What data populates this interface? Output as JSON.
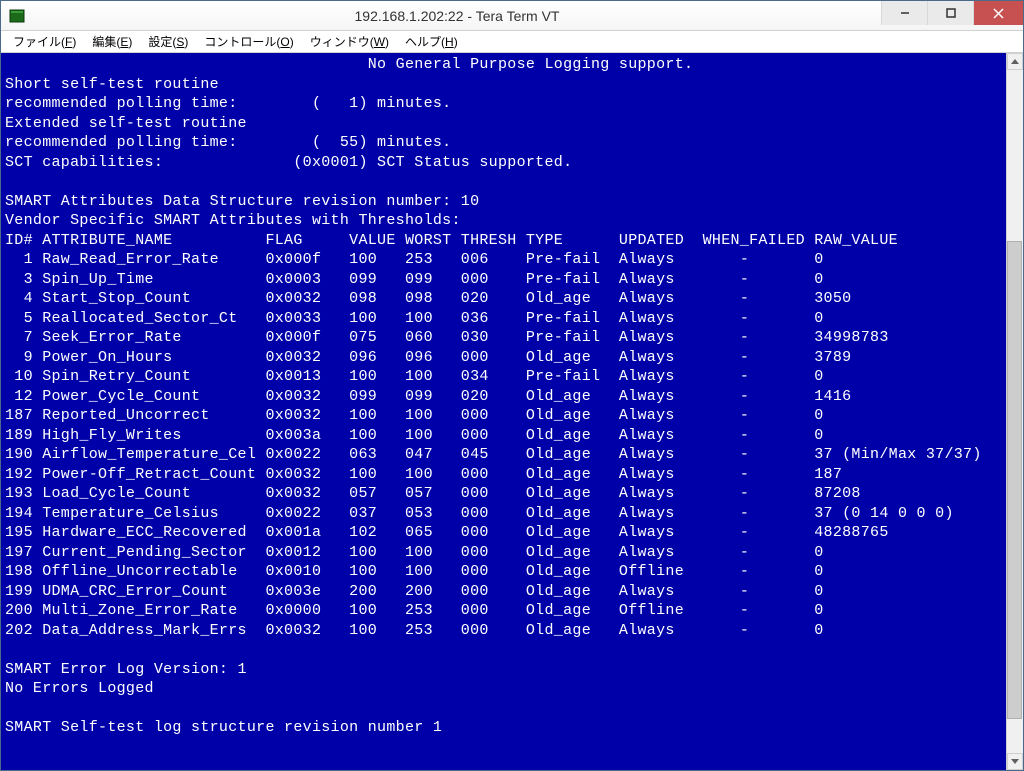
{
  "window": {
    "title": "192.168.1.202:22 - Tera Term VT"
  },
  "menu": {
    "file": "ファイル(",
    "file_u": "F",
    "file_end": ")",
    "edit": "編集(",
    "edit_u": "E",
    "edit_end": ")",
    "setup": "設定(",
    "setup_u": "S",
    "setup_end": ")",
    "control": "コントロール(",
    "control_u": "O",
    "control_end": ")",
    "window_m": "ウィンドウ(",
    "window_u": "W",
    "window_end": ")",
    "help": "ヘルプ(",
    "help_u": "H",
    "help_end": ")"
  },
  "term": {
    "line0": "                                       No General Purpose Logging support.",
    "line1": "Short self-test routine",
    "line2": "recommended polling time:        (   1) minutes.",
    "line3": "Extended self-test routine",
    "line4": "recommended polling time:        (  55) minutes.",
    "line5": "SCT capabilities:              (0x0001) SCT Status supported.",
    "line6": "",
    "line7": "SMART Attributes Data Structure revision number: 10",
    "line8": "Vendor Specific SMART Attributes with Thresholds:",
    "header": "ID# ATTRIBUTE_NAME          FLAG     VALUE WORST THRESH TYPE      UPDATED  WHEN_FAILED RAW_VALUE",
    "rows": [
      "  1 Raw_Read_Error_Rate     0x000f   100   253   006    Pre-fail  Always       -       0",
      "  3 Spin_Up_Time            0x0003   099   099   000    Pre-fail  Always       -       0",
      "  4 Start_Stop_Count        0x0032   098   098   020    Old_age   Always       -       3050",
      "  5 Reallocated_Sector_Ct   0x0033   100   100   036    Pre-fail  Always       -       0",
      "  7 Seek_Error_Rate         0x000f   075   060   030    Pre-fail  Always       -       34998783",
      "  9 Power_On_Hours          0x0032   096   096   000    Old_age   Always       -       3789",
      " 10 Spin_Retry_Count        0x0013   100   100   034    Pre-fail  Always       -       0",
      " 12 Power_Cycle_Count       0x0032   099   099   020    Old_age   Always       -       1416",
      "187 Reported_Uncorrect      0x0032   100   100   000    Old_age   Always       -       0",
      "189 High_Fly_Writes         0x003a   100   100   000    Old_age   Always       -       0",
      "190 Airflow_Temperature_Cel 0x0022   063   047   045    Old_age   Always       -       37 (Min/Max 37/37)",
      "192 Power-Off_Retract_Count 0x0032   100   100   000    Old_age   Always       -       187",
      "193 Load_Cycle_Count        0x0032   057   057   000    Old_age   Always       -       87208",
      "194 Temperature_Celsius     0x0022   037   053   000    Old_age   Always       -       37 (0 14 0 0 0)",
      "195 Hardware_ECC_Recovered  0x001a   102   065   000    Old_age   Always       -       48288765",
      "197 Current_Pending_Sector  0x0012   100   100   000    Old_age   Always       -       0",
      "198 Offline_Uncorrectable   0x0010   100   100   000    Old_age   Offline      -       0",
      "199 UDMA_CRC_Error_Count    0x003e   200   200   000    Old_age   Always       -       0",
      "200 Multi_Zone_Error_Rate   0x0000   100   253   000    Old_age   Offline      -       0",
      "202 Data_Address_Mark_Errs  0x0032   100   253   000    Old_age   Always       -       0"
    ],
    "tail0": "",
    "tail1": "SMART Error Log Version: 1",
    "tail2": "No Errors Logged",
    "tail3": "",
    "tail4": "SMART Self-test log structure revision number 1"
  }
}
